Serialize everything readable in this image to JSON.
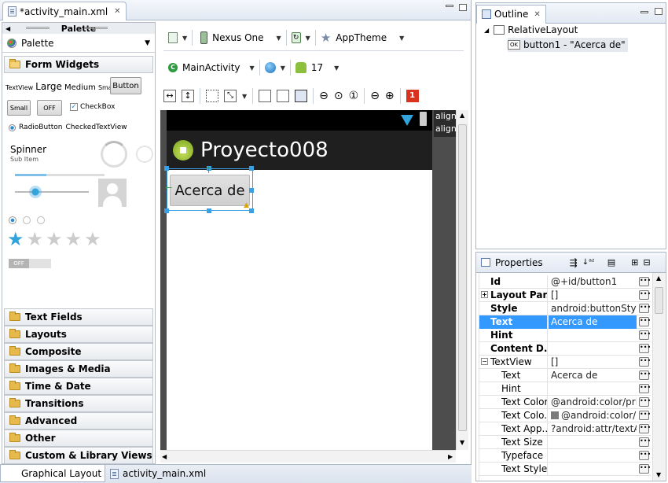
{
  "editor": {
    "tab_label": "*activity_main.xml",
    "bottom_tabs": [
      "Graphical Layout",
      "activity_main.xml"
    ]
  },
  "palette": {
    "header": "Palette",
    "title": "Palette",
    "open_category": "Form Widgets",
    "widgets": {
      "textview_row": [
        "TextView",
        "Large",
        "Medium",
        "Small"
      ],
      "button": "Button",
      "small_button": "Small",
      "toggle": "OFF",
      "checkbox": "CheckBox",
      "radio_row": [
        "RadioButton",
        "CheckedTextView"
      ],
      "spinner": "Spinner",
      "spinner_sub": "Sub Item",
      "switch_off": "OFF"
    },
    "categories": [
      "Text Fields",
      "Layouts",
      "Composite",
      "Images & Media",
      "Time & Date",
      "Transitions",
      "Advanced",
      "Other",
      "Custom & Library Views"
    ]
  },
  "toolbar": {
    "device": "Nexus One",
    "theme": "AppTheme",
    "activity": "MainActivity",
    "api_level": "17",
    "error_count": "1"
  },
  "device_screen": {
    "app_title": "Proyecto008",
    "button_text": "Acerca de",
    "hint_lines": [
      "align",
      "align"
    ]
  },
  "outline": {
    "tab_label": "Outline",
    "root": "RelativeLayout",
    "child": "button1 - \"Acerca de\""
  },
  "properties": {
    "tab_label": "Properties",
    "rows": [
      {
        "name": "Id",
        "value": "@+id/button1",
        "bold": true
      },
      {
        "name": "Layout Par...",
        "value": "[]",
        "bold": true,
        "expander": "+"
      },
      {
        "name": "Style",
        "value": "android:buttonStyle",
        "bold": true
      },
      {
        "name": "Text",
        "value": "Acerca de",
        "bold": true,
        "selected": true
      },
      {
        "name": "Hint",
        "value": "",
        "bold": true
      },
      {
        "name": "Content D...",
        "value": "",
        "bold": true
      },
      {
        "name": "TextView",
        "value": "[]",
        "expander": "−"
      },
      {
        "name": "Text",
        "value": "Acerca de",
        "indent": true
      },
      {
        "name": "Hint",
        "value": "",
        "indent": true
      },
      {
        "name": "Text Color",
        "value": "@android:color/pri...",
        "indent": true
      },
      {
        "name": "Text Colo...",
        "value": "@android:color/...",
        "indent": true,
        "swatch": true
      },
      {
        "name": "Text App...",
        "value": "?android:attr/textA...",
        "indent": true
      },
      {
        "name": "Text Size",
        "value": "",
        "indent": true
      },
      {
        "name": "Typeface",
        "value": "",
        "indent": true
      },
      {
        "name": "Text Style",
        "value": "",
        "indent": true
      }
    ]
  },
  "colors": {
    "accent": "#3399ff",
    "actionbar": "#1f1f1f",
    "selection": "#3aa0e6"
  }
}
